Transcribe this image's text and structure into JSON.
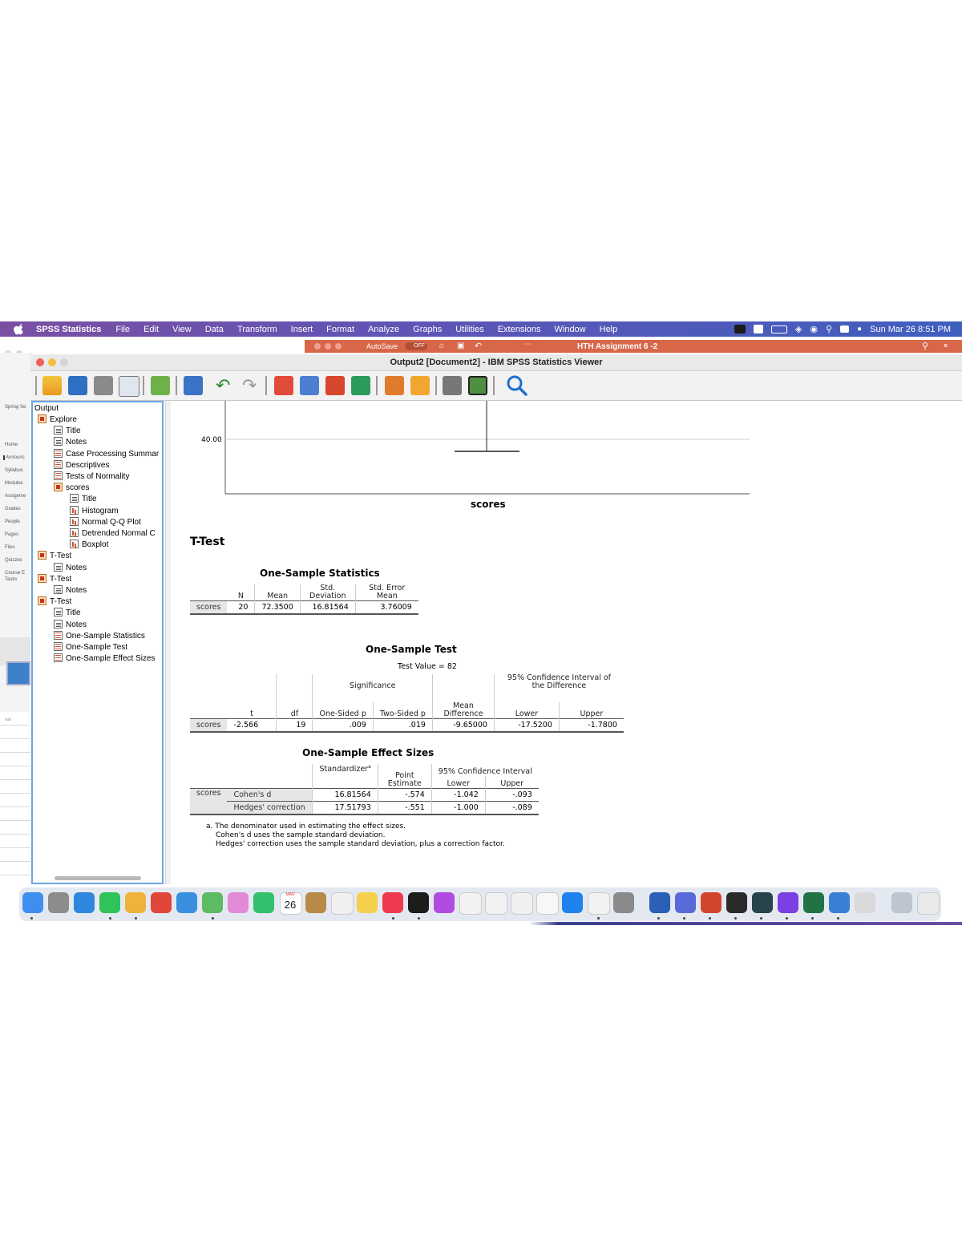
{
  "menubar": {
    "app_name": "SPSS Statistics",
    "items": [
      "File",
      "Edit",
      "View",
      "Data",
      "Transform",
      "Insert",
      "Format",
      "Analyze",
      "Graphs",
      "Utilities",
      "Extensions",
      "Window",
      "Help"
    ],
    "clock": "Sun Mar 26 8:51 PM"
  },
  "background_word": {
    "autosave": "AutoSave",
    "autosave_state": "OFF",
    "doc_title": "HTH Assignment 6 -2"
  },
  "canvas_nav": [
    "Spring Se",
    "Home",
    "Announc",
    "Syllabus",
    "Modules",
    "Assignme",
    "Grades",
    "People",
    "Pages",
    "Files",
    "Quizzes",
    "Course E",
    "Tasks"
  ],
  "spreadsheet_label": "var",
  "window": {
    "title": "Output2 [Document2] - IBM SPSS Statistics Viewer"
  },
  "outline": {
    "root": "Output",
    "items": [
      {
        "label": "Explore",
        "icon": "book",
        "level": 1
      },
      {
        "label": "Title",
        "icon": "note",
        "level": 2
      },
      {
        "label": "Notes",
        "icon": "note",
        "level": 2
      },
      {
        "label": "Case Processing Summar",
        "icon": "table",
        "level": 2
      },
      {
        "label": "Descriptives",
        "icon": "table",
        "level": 2
      },
      {
        "label": "Tests of Normality",
        "icon": "table",
        "level": 2
      },
      {
        "label": "scores",
        "icon": "book",
        "level": 2
      },
      {
        "label": "Title",
        "icon": "note",
        "level": 3
      },
      {
        "label": "Histogram",
        "icon": "chart",
        "level": 3
      },
      {
        "label": "Normal Q-Q Plot",
        "icon": "chart",
        "level": 3
      },
      {
        "label": "Detrended Normal C",
        "icon": "chart",
        "level": 3
      },
      {
        "label": "Boxplot",
        "icon": "chart",
        "level": 3
      },
      {
        "label": "T-Test",
        "icon": "book",
        "level": 1
      },
      {
        "label": "Notes",
        "icon": "note",
        "level": 2
      },
      {
        "label": "T-Test",
        "icon": "book",
        "level": 1
      },
      {
        "label": "Notes",
        "icon": "note",
        "level": 2
      },
      {
        "label": "T-Test",
        "icon": "book",
        "level": 1
      },
      {
        "label": "Title",
        "icon": "note",
        "level": 2
      },
      {
        "label": "Notes",
        "icon": "note",
        "level": 2
      },
      {
        "label": "One-Sample Statistics",
        "icon": "table",
        "level": 2
      },
      {
        "label": "One-Sample Test",
        "icon": "table",
        "level": 2
      },
      {
        "label": "One-Sample Effect Sizes",
        "icon": "table",
        "level": 2
      }
    ]
  },
  "boxplot": {
    "y_tick": "40.00",
    "x_label": "scores"
  },
  "ttest_title": "T-Test",
  "stats_table": {
    "title": "One-Sample Statistics",
    "headers": [
      "N",
      "Mean",
      "Std.\nDeviation",
      "Std. Error\nMean"
    ],
    "row_label": "scores",
    "values": [
      "20",
      "72.3500",
      "16.81564",
      "3.76009"
    ]
  },
  "test_table": {
    "title": "One-Sample Test",
    "test_value": "Test Value = 82",
    "group_significance": "Significance",
    "group_ci": "95% Confidence Interval of\nthe Difference",
    "headers": [
      "t",
      "df",
      "One-Sided p",
      "Two-Sided p",
      "Mean\nDifference",
      "Lower",
      "Upper"
    ],
    "row_label": "scores",
    "values": [
      "-2.566",
      "19",
      ".009",
      ".019",
      "-9.65000",
      "-17.5200",
      "-1.7800"
    ]
  },
  "effect_table": {
    "title": "One-Sample Effect Sizes",
    "h_standardizer": "Standardizer",
    "h_standardizer_sup": "a",
    "h_point": "Point\nEstimate",
    "h_ci": "95% Confidence Interval",
    "h_lower": "Lower",
    "h_upper": "Upper",
    "row_label": "scores",
    "rows": [
      {
        "label": "Cohen's d",
        "values": [
          "16.81564",
          "-.574",
          "-1.042",
          "-.093"
        ]
      },
      {
        "label": "Hedges' correction",
        "values": [
          "17.51793",
          "-.551",
          "-1.000",
          "-.089"
        ]
      }
    ],
    "footnotes": [
      "a. The denominator used in estimating the effect sizes.",
      "Cohen's d uses the sample standard deviation.",
      "Hedges' correction uses the sample standard deviation, plus a correction factor."
    ]
  },
  "dock": {
    "calendar_day": "26",
    "calendar_month": "MAR"
  },
  "colors": {
    "menubar_left": "#7a4fa3",
    "menubar_right": "#3f5fbf",
    "word_bar": "#d8674a",
    "outline_border": "#6aa6e6",
    "row_label_bg": "#e6e6e6"
  }
}
